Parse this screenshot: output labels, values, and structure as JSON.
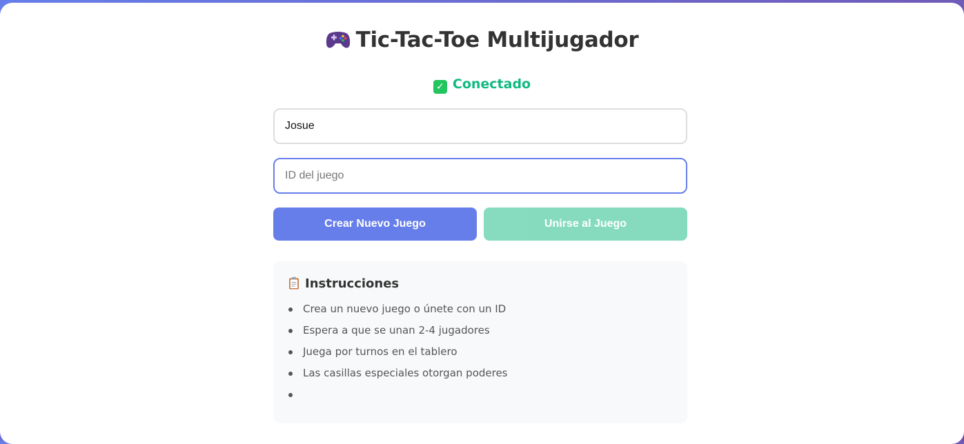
{
  "header": {
    "title": "Tic-Tac-Toe Multijugador",
    "title_icon": "gamepad-icon"
  },
  "status": {
    "text": "Conectado",
    "icon": "check-icon",
    "color": "#10b981"
  },
  "form": {
    "name_value": "Josue",
    "game_id_value": "",
    "game_id_placeholder": "ID del juego"
  },
  "actions": {
    "create_label": "Crear Nuevo Juego",
    "join_label": "Unirse al Juego"
  },
  "instructions": {
    "icon": "clipboard-icon",
    "title": "Instrucciones",
    "items": [
      "Crea un nuevo juego o únete con un ID",
      "Espera a que se unan 2-4 jugadores",
      "Juega por turnos en el tablero",
      "Las casillas especiales otorgan poderes",
      ""
    ]
  },
  "colors": {
    "accent": "#667eea",
    "success": "#10b981",
    "background_gradient": [
      "#667eea",
      "#764ba2"
    ]
  }
}
